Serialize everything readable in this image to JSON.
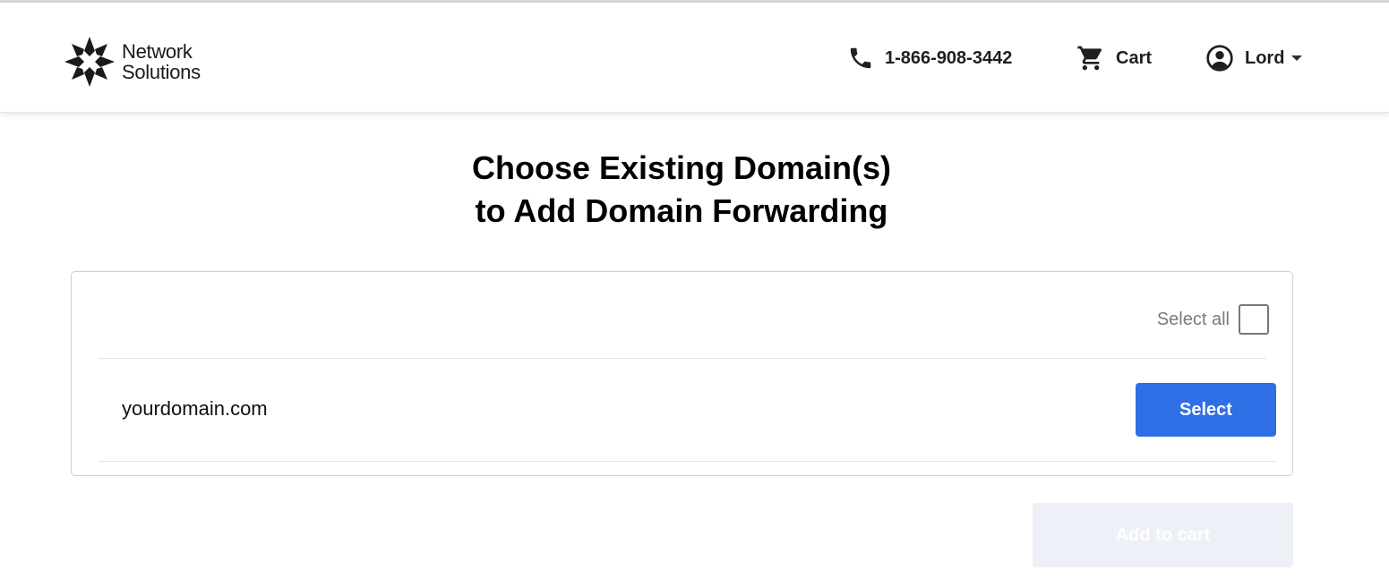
{
  "header": {
    "logo_line1": "Network",
    "logo_line2": "Solutions",
    "phone": {
      "icon": "phone-icon",
      "label": "1-866-908-3442"
    },
    "cart": {
      "icon": "cart-icon",
      "label": "Cart"
    },
    "account": {
      "icon": "user-circle-icon",
      "label": "Lord"
    }
  },
  "page": {
    "title_line1": "Choose Existing Domain(s)",
    "title_line2": "to Add Domain Forwarding"
  },
  "domains": {
    "select_all_label": "Select all",
    "select_all_checked": false,
    "items": [
      {
        "name": "yourdomain.com",
        "button_label": "Select"
      }
    ]
  },
  "actions": {
    "add_to_cart_label": "Add to cart",
    "add_to_cart_enabled": false
  },
  "colors": {
    "primary": "#2f6fe6",
    "disabled_bg": "#edf0f6",
    "text": "#111111",
    "muted": "#7a7a7a"
  }
}
